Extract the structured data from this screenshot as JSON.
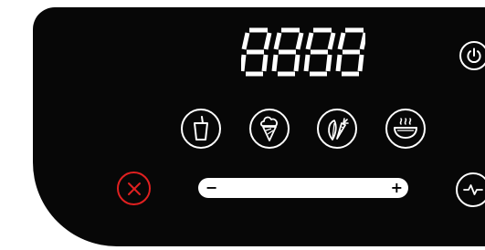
{
  "control_panel": {
    "display": {
      "value": "8888",
      "color": "#ffffff"
    },
    "buttons": {
      "power": {
        "icon": "power-icon"
      },
      "programs": [
        {
          "icon": "smoothie-cup-icon"
        },
        {
          "icon": "ice-cream-icon"
        },
        {
          "icon": "vegetables-icon"
        },
        {
          "icon": "soup-bowl-icon"
        }
      ],
      "cancel": {
        "icon": "cancel-x-icon",
        "color": "#e02020"
      },
      "pulse": {
        "icon": "pulse-wave-icon"
      }
    },
    "speed_slider": {
      "minus_label": "−",
      "plus_label": "+"
    }
  }
}
